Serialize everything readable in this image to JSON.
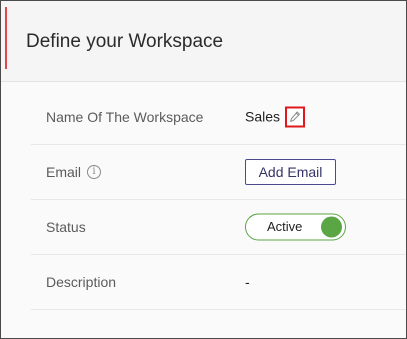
{
  "header": {
    "title": "Define your Workspace"
  },
  "fields": {
    "name": {
      "label": "Name Of The Workspace",
      "value": "Sales",
      "edit_icon": "pencil-icon"
    },
    "email": {
      "label": "Email",
      "info_icon": "info-icon",
      "info_glyph": "i",
      "button_label": "Add Email"
    },
    "status": {
      "label": "Status",
      "value": "Active"
    },
    "description": {
      "label": "Description",
      "value": "-"
    }
  },
  "colors": {
    "accent": "#e0474c",
    "highlight_box": "#e0181b",
    "button_border": "#4b4a8e",
    "toggle_on": "#5aa544"
  }
}
